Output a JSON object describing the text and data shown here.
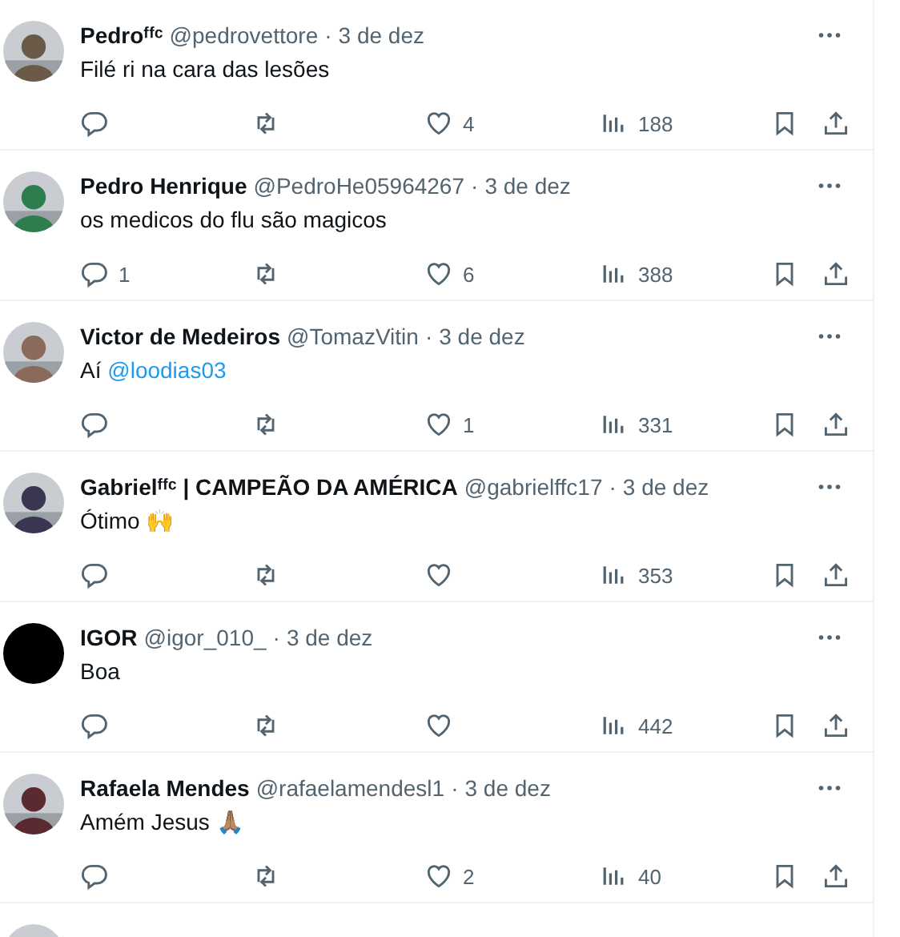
{
  "replies": [
    {
      "avatar": {
        "kind": "picture"
      },
      "name": "Pedroᶠᶠᶜ",
      "handle": "@pedrovettore",
      "dot": "·",
      "time": "3 de dez",
      "body": [
        {
          "kind": "text",
          "text": "Filé ri na cara das lesões"
        }
      ],
      "likes": "4",
      "views": "188"
    },
    {
      "avatar": {
        "kind": "picture"
      },
      "name": "Pedro Henrique",
      "handle": "@PedroHe05964267",
      "dot": "·",
      "time": "3 de dez",
      "body": [
        {
          "kind": "text",
          "text": "os medicos do flu são magicos"
        }
      ],
      "reply_count": "1",
      "likes": "6",
      "views": "388"
    },
    {
      "avatar": {
        "kind": "picture"
      },
      "name": "Victor de Medeiros",
      "handle": "@TomazVitin",
      "dot": "·",
      "time": "3 de dez",
      "body": [
        {
          "kind": "text",
          "text": "Aí "
        },
        {
          "kind": "mention",
          "text": "@loodias03"
        }
      ],
      "likes": "1",
      "views": "331"
    },
    {
      "avatar": {
        "kind": "picture"
      },
      "name": "Gabrielᶠᶠᶜ | CAMPEÃO DA AMÉRICA",
      "handle": "@gabrielffc17",
      "dot": "·",
      "time": "3 de dez",
      "body": [
        {
          "kind": "text",
          "text": "Ótimo 🙌"
        }
      ],
      "views": "353"
    },
    {
      "avatar": {
        "kind": "blank"
      },
      "name": "IGOR",
      "handle": "@igor_010_",
      "dot": "·",
      "time": "3 de dez",
      "body": [
        {
          "kind": "text",
          "text": "Boa"
        }
      ],
      "views": "442"
    },
    {
      "avatar": {
        "kind": "picture"
      },
      "name": "Rafaela Mendes",
      "handle": "@rafaelamendesl1",
      "dot": "·",
      "time": "3 de dez",
      "body": [
        {
          "kind": "text",
          "text": "Amém Jesus 🙏🏽"
        }
      ],
      "likes": "2",
      "views": "40"
    },
    {
      "avatar": {
        "kind": "picture"
      }
    }
  ]
}
